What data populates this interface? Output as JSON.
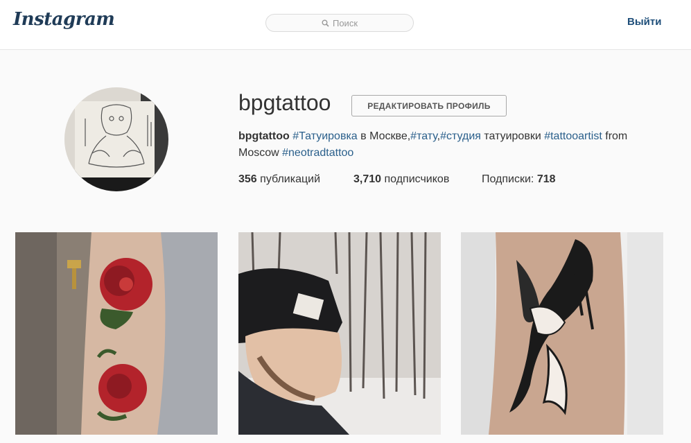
{
  "header": {
    "logo": "Instagram",
    "search_placeholder": "Поиск",
    "logout_label": "Выйти"
  },
  "profile": {
    "username": "bpgtattoo",
    "edit_button": "РЕДАКТИРОВАТЬ ПРОФИЛЬ",
    "bio": [
      {
        "text": "bpgtattoo",
        "kind": "name"
      },
      {
        "text": " ",
        "kind": "text"
      },
      {
        "text": "#Татуировка",
        "kind": "tag"
      },
      {
        "text": " в Москве,",
        "kind": "text"
      },
      {
        "text": "#тату",
        "kind": "tag"
      },
      {
        "text": ",",
        "kind": "text"
      },
      {
        "text": "#студия",
        "kind": "tag"
      },
      {
        "text": " татуировки ",
        "kind": "text"
      },
      {
        "text": "#tattooartist",
        "kind": "tag"
      },
      {
        "text": " from Moscow ",
        "kind": "text"
      },
      {
        "text": "#neotradtattoo",
        "kind": "tag"
      }
    ],
    "stats": {
      "posts_count": "356",
      "posts_label": " публикаций",
      "followers_count": "3,710",
      "followers_label": " подписчиков",
      "following_label": "Подписки: ",
      "following_count": "718"
    }
  },
  "posts": [
    {
      "alt": "rose tattoo on arm"
    },
    {
      "alt": "man in black beanie in winter forest"
    },
    {
      "alt": "swallow bird tattoo with ribbon"
    }
  ],
  "colors": {
    "link": "#2a5f8b",
    "logo": "#1f3b57",
    "logout": "#1f4f7a"
  }
}
